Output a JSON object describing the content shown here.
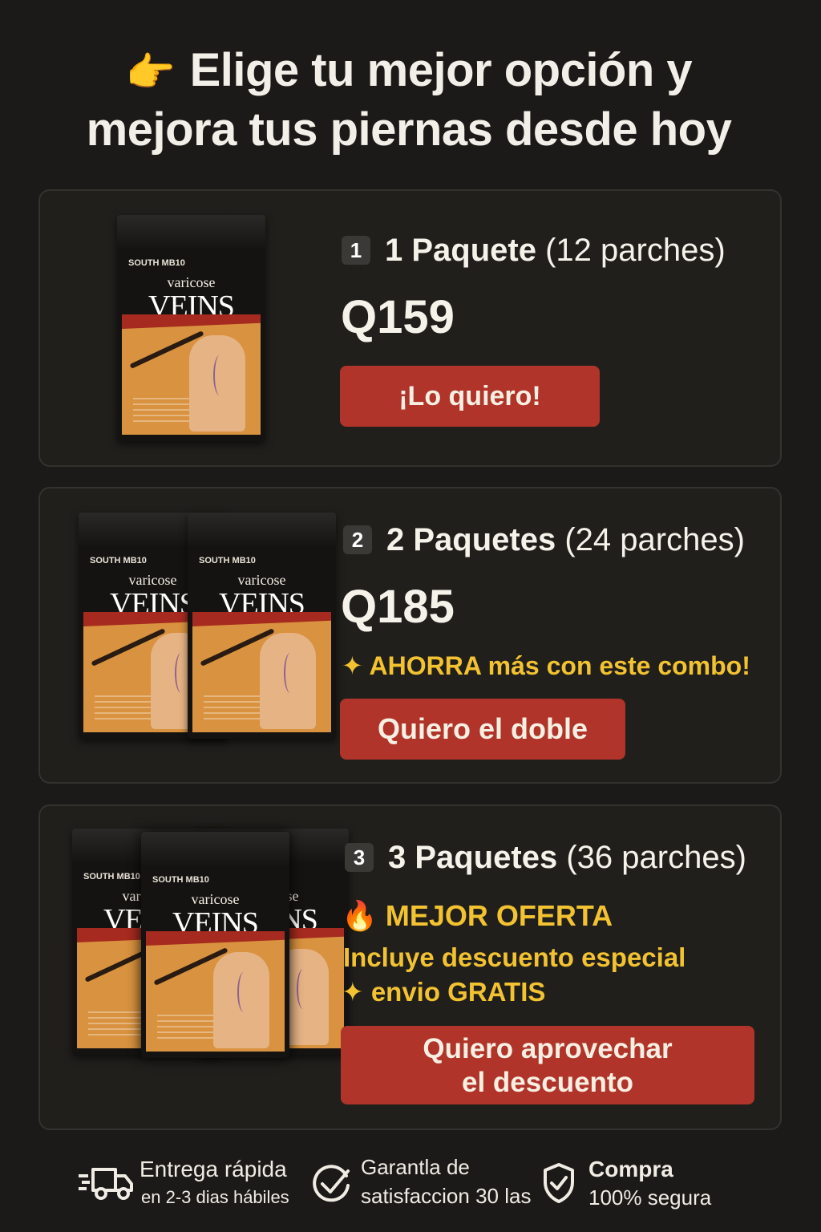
{
  "headline": {
    "emoji": "👉",
    "line1": "Elige tu mejor opción y",
    "line2": "mejora tus piernas desde hoy"
  },
  "pack_labels": {
    "brand": "SOUTH MB10",
    "title_small": "varicose",
    "title_big": "VEINS"
  },
  "offers": [
    {
      "number": "1",
      "name": "1 Paquete",
      "count": "(12 parches)",
      "price": "Q159",
      "button": "¡Lo quiero!"
    },
    {
      "number": "2",
      "name": "2 Paquetes",
      "count": "(24 parches)",
      "price": "Q185",
      "note": "✦ AHORRA más con este combo!",
      "button": "Quiero el doble"
    },
    {
      "number": "3",
      "name": "3 Paquetes",
      "count": "(36 parches)",
      "badge": "🔥 MEJOR OFERTA",
      "note_line1": "Incluye descuento especial",
      "note_line2": "✦ envio GRATIS",
      "button_line1": "Quiero aprovechar",
      "button_line2": "el descuento"
    }
  ],
  "footer": [
    {
      "icon": "truck-icon",
      "line1": "Entrega rápida",
      "line2": "en 2-3 dias hábiles"
    },
    {
      "icon": "check-circle-icon",
      "line1": "Garantla de",
      "line2": "satisfaccion 30 las"
    },
    {
      "icon": "shield-check-icon",
      "line1": "Compra",
      "line2": "100% segura"
    }
  ],
  "colors": {
    "background": "#1b1a18",
    "button": "#b0342a",
    "highlight": "#f2c230"
  }
}
